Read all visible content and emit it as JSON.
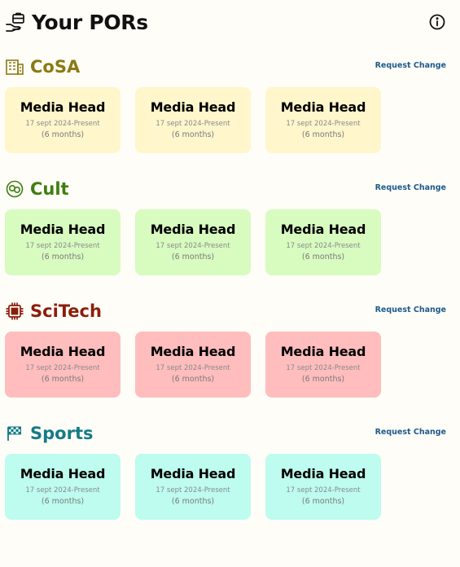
{
  "header": {
    "title": "Your PORs",
    "icon": "briefcase-hand-icon",
    "info_icon": "info-icon"
  },
  "sections": [
    {
      "title": "CoSA",
      "icon": "building-icon",
      "color": "#8a7a12",
      "card_bg": "#fff6cc",
      "request_label": "Request Change",
      "cards": [
        {
          "role": "Media Head",
          "date": "17 sept 2024-Present",
          "duration": "(6 months)"
        },
        {
          "role": "Media Head",
          "date": "17 sept 2024-Present",
          "duration": "(6 months)"
        },
        {
          "role": "Media Head",
          "date": "17 sept 2024-Present",
          "duration": "(6 months)"
        }
      ]
    },
    {
      "title": "Cult",
      "icon": "theater-icon",
      "color": "#3f7d12",
      "card_bg": "#d8fbc0",
      "request_label": "Request Change",
      "cards": [
        {
          "role": "Media Head",
          "date": "17 sept 2024-Present",
          "duration": "(6 months)"
        },
        {
          "role": "Media Head",
          "date": "17 sept 2024-Present",
          "duration": "(6 months)"
        },
        {
          "role": "Media Head",
          "date": "17 sept 2024-Present",
          "duration": "(6 months)"
        }
      ]
    },
    {
      "title": "SciTech",
      "icon": "chip-icon",
      "color": "#8a1e0c",
      "card_bg": "#ffbdbd",
      "request_label": "Request Change",
      "cards": [
        {
          "role": "Media Head",
          "date": "17 sept 2024-Present",
          "duration": "(6 months)"
        },
        {
          "role": "Media Head",
          "date": "17 sept 2024-Present",
          "duration": "(6 months)"
        },
        {
          "role": "Media Head",
          "date": "17 sept 2024-Present",
          "duration": "(6 months)"
        }
      ]
    },
    {
      "title": "Sports",
      "icon": "checkered-flag-icon",
      "color": "#157a88",
      "card_bg": "#bdfcee",
      "request_label": "Request Change",
      "cards": [
        {
          "role": "Media Head",
          "date": "17 sept 2024-Present",
          "duration": "(6 months)"
        },
        {
          "role": "Media Head",
          "date": "17 sept 2024-Present",
          "duration": "(6 months)"
        },
        {
          "role": "Media Head",
          "date": "17 sept 2024-Present",
          "duration": "(6 months)"
        }
      ]
    }
  ]
}
